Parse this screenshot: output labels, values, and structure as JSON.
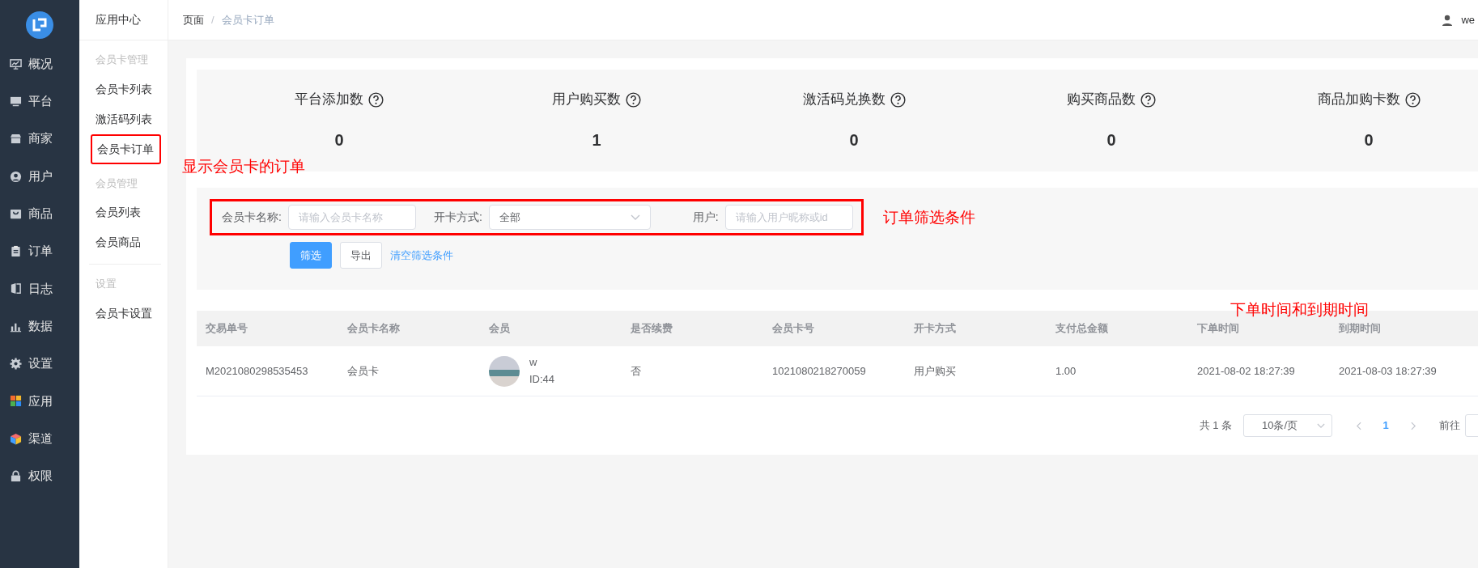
{
  "sidebar": {
    "items": [
      {
        "label": "概况"
      },
      {
        "label": "平台"
      },
      {
        "label": "商家"
      },
      {
        "label": "用户"
      },
      {
        "label": "商品"
      },
      {
        "label": "订单"
      },
      {
        "label": "日志"
      },
      {
        "label": "数据"
      },
      {
        "label": "设置"
      },
      {
        "label": "应用"
      },
      {
        "label": "渠道"
      },
      {
        "label": "权限"
      }
    ]
  },
  "subnav": {
    "title": "应用中心",
    "groups": [
      {
        "heading": "会员卡管理",
        "items": [
          {
            "label": "会员卡列表",
            "annotated": false
          },
          {
            "label": "激活码列表",
            "annotated": false
          },
          {
            "label": "会员卡订单",
            "annotated": true
          }
        ]
      },
      {
        "heading": "会员管理",
        "items": [
          {
            "label": "会员列表",
            "annotated": false
          },
          {
            "label": "会员商品",
            "annotated": false
          }
        ]
      },
      {
        "heading": "设置",
        "items": [
          {
            "label": "会员卡设置",
            "annotated": false
          }
        ]
      }
    ]
  },
  "breadcrumb": {
    "separator": "/",
    "items": [
      "页面",
      "会员卡订单"
    ]
  },
  "user": {
    "name": "we"
  },
  "stats": [
    {
      "label": "平台添加数",
      "value": "0"
    },
    {
      "label": "用户购买数",
      "value": "1"
    },
    {
      "label": "激活码兑换数",
      "value": "0"
    },
    {
      "label": "购买商品数",
      "value": "0"
    },
    {
      "label": "商品加购卡数",
      "value": "0"
    }
  ],
  "filters": {
    "annotated": true,
    "fields": [
      {
        "kind": "input",
        "label": "会员卡名称:",
        "placeholder": "请输入会员卡名称"
      },
      {
        "kind": "select",
        "label": "开卡方式:",
        "value": "全部"
      },
      {
        "kind": "input",
        "label": "用户:",
        "placeholder": "请输入用户昵称或id"
      }
    ],
    "buttons": [
      {
        "kind": "primary",
        "label": "筛选"
      },
      {
        "kind": "default",
        "label": "导出"
      },
      {
        "kind": "link",
        "label": "清空筛选条件"
      }
    ]
  },
  "table": {
    "columns": [
      "交易单号",
      "会员卡名称",
      "会员",
      "是否续费",
      "会员卡号",
      "开卡方式",
      "支付总金额",
      "下单时间",
      "到期时间"
    ],
    "rows": [
      {
        "cells": [
          {
            "kind": "text",
            "text": "M2021080298535453"
          },
          {
            "kind": "text",
            "text": "会员卡"
          },
          {
            "kind": "member",
            "name": "w",
            "id": "ID:44"
          },
          {
            "kind": "text",
            "text": "否"
          },
          {
            "kind": "text",
            "text": "1021080218270059"
          },
          {
            "kind": "text",
            "text": "用户购买"
          },
          {
            "kind": "text",
            "text": "1.00"
          },
          {
            "kind": "text",
            "text": "2021-08-02 18:27:39"
          },
          {
            "kind": "text",
            "text": "2021-08-03 18:27:39"
          }
        ]
      }
    ]
  },
  "pagination": {
    "total": "共 1 条",
    "page_size": "10条/页",
    "pages": [
      {
        "label": "1",
        "selected": true
      }
    ],
    "goto_label": "前往"
  },
  "annotations": [
    {
      "text": "显示会员卡的订单"
    },
    {
      "text": "订单筛选条件"
    },
    {
      "text": "下单时间和到期时间"
    }
  ]
}
